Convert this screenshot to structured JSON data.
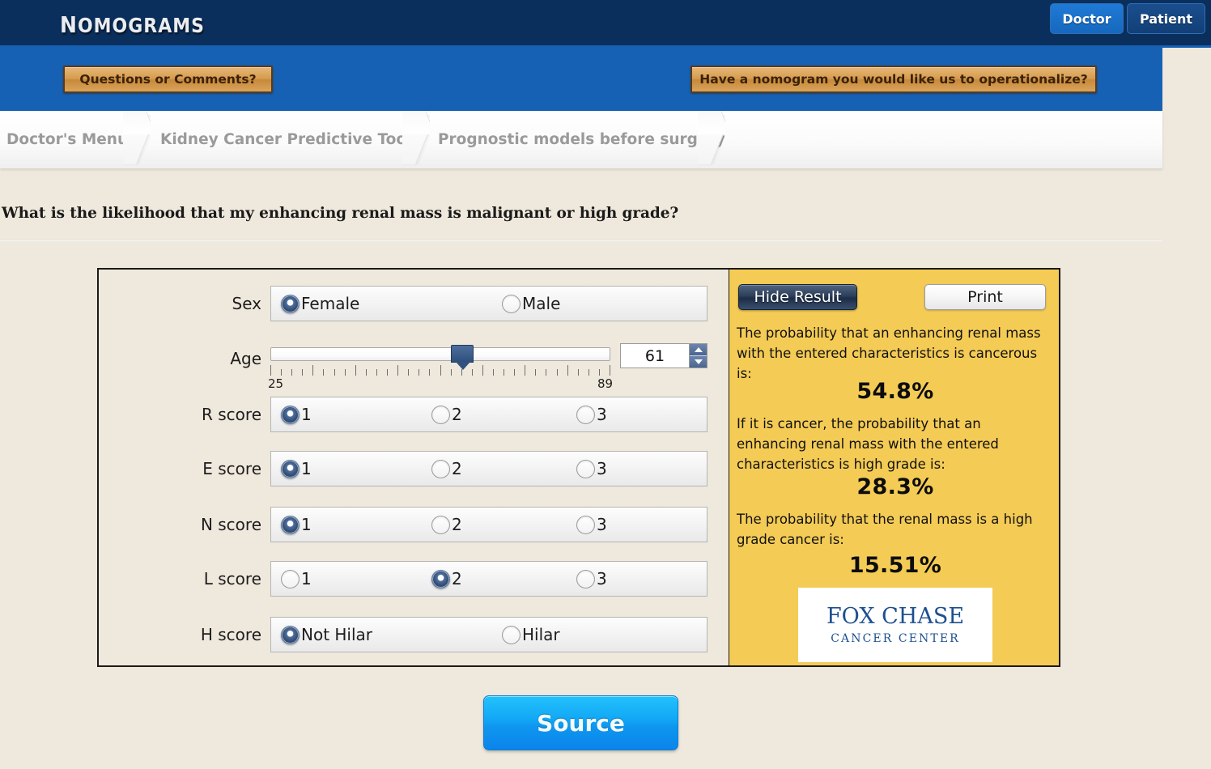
{
  "header": {
    "logo_text": "Nomograms",
    "doctor_tab": "Doctor",
    "patient_tab": "Patient"
  },
  "actionbar": {
    "questions_button": "Questions or Comments?",
    "operationalize_button": "Have a nomogram you would like us to operationalize?"
  },
  "breadcrumb": {
    "items": [
      {
        "label": "Doctor's Menu"
      },
      {
        "label": "Kidney Cancer Predictive Tools"
      },
      {
        "label": "Prognostic models before surgery"
      }
    ]
  },
  "page": {
    "title": "What is the likelihood that my enhancing renal mass is malignant or high grade?"
  },
  "form": {
    "sex": {
      "label": "Sex",
      "options": [
        {
          "label": "Female",
          "selected": true
        },
        {
          "label": "Male",
          "selected": false
        }
      ]
    },
    "age": {
      "label": "Age",
      "value": "61",
      "min": "25",
      "max": "89"
    },
    "r_score": {
      "label": "R score",
      "options": [
        {
          "label": "1",
          "selected": true
        },
        {
          "label": "2",
          "selected": false
        },
        {
          "label": "3",
          "selected": false
        }
      ]
    },
    "e_score": {
      "label": "E score",
      "options": [
        {
          "label": "1",
          "selected": true
        },
        {
          "label": "2",
          "selected": false
        },
        {
          "label": "3",
          "selected": false
        }
      ]
    },
    "n_score": {
      "label": "N score",
      "options": [
        {
          "label": "1",
          "selected": true
        },
        {
          "label": "2",
          "selected": false
        },
        {
          "label": "3",
          "selected": false
        }
      ]
    },
    "l_score": {
      "label": "L score",
      "options": [
        {
          "label": "1",
          "selected": false
        },
        {
          "label": "2",
          "selected": true
        },
        {
          "label": "3",
          "selected": false
        }
      ]
    },
    "h_score": {
      "label": "H score",
      "options": [
        {
          "label": "Not Hilar",
          "selected": true
        },
        {
          "label": "Hilar",
          "selected": false
        }
      ]
    }
  },
  "result": {
    "hide_button": "Hide Result",
    "print_button": "Print",
    "blocks": [
      {
        "text": "The probability that an enhancing renal mass with the entered characteristics is cancerous is:",
        "value": "54.8%"
      },
      {
        "text": "If it is cancer, the probability that an enhancing renal mass with the entered characteristics is high grade is:",
        "value": "28.3%"
      },
      {
        "text": "The probability that the renal mass is a high grade cancer is:",
        "value": "15.51%"
      }
    ],
    "logo_line1": "FOX CHASE",
    "logo_line2": "CANCER CENTER"
  },
  "footer": {
    "source_button": "Source"
  },
  "colors": {
    "navy": "#0b2f5c",
    "blue_bar": "#1761b4",
    "page_bg": "#efe8dc",
    "result_bg": "#f4cb55",
    "source_blue": "#13a8f6",
    "tan_button": "#d59b4e",
    "fox_chase_navy": "#1d4f8f"
  }
}
